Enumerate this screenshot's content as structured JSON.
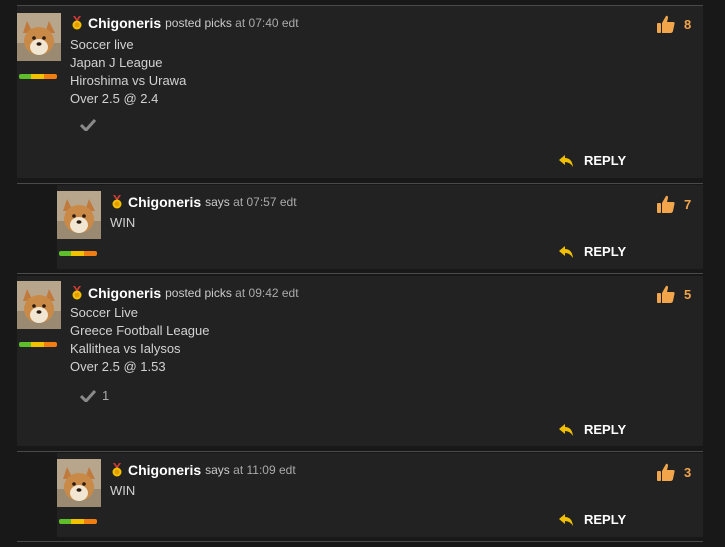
{
  "colors": {
    "background": "#181818",
    "card": "#222222",
    "accent": "#f2a54a",
    "reply_arrow": "#f0c000",
    "rating_bar": [
      "#5fbf2a",
      "#f2c200",
      "#f27e12"
    ]
  },
  "icons": {
    "medal": "medal-icon",
    "like": "thumbs-up-icon",
    "reply": "reply-arrow-icon",
    "check": "checkmark-icon"
  },
  "posts": [
    {
      "username": "Chigoneris",
      "verb": "posted picks",
      "time": "at 07:40 edt",
      "lines": [
        "Soccer live",
        "Japan J League",
        "Hiroshima vs Urawa",
        "Over 2.5 @ 2.4"
      ],
      "check_count": "",
      "likes": "8",
      "reply_label": "REPLY"
    },
    {
      "username": "Chigoneris",
      "verb": "says",
      "time": "at 07:57 edt",
      "text": "WIN",
      "likes": "7",
      "reply_label": "REPLY"
    },
    {
      "username": "Chigoneris",
      "verb": "posted picks",
      "time": "at 09:42 edt",
      "lines": [
        "Soccer Live",
        "Greece Football League",
        "Kallithea vs Ialysos",
        "Over 2.5 @ 1.53"
      ],
      "check_count": "1",
      "likes": "5",
      "reply_label": "REPLY"
    },
    {
      "username": "Chigoneris",
      "verb": "says",
      "time": "at 11:09 edt",
      "text": "WIN",
      "likes": "3",
      "reply_label": "REPLY"
    }
  ]
}
